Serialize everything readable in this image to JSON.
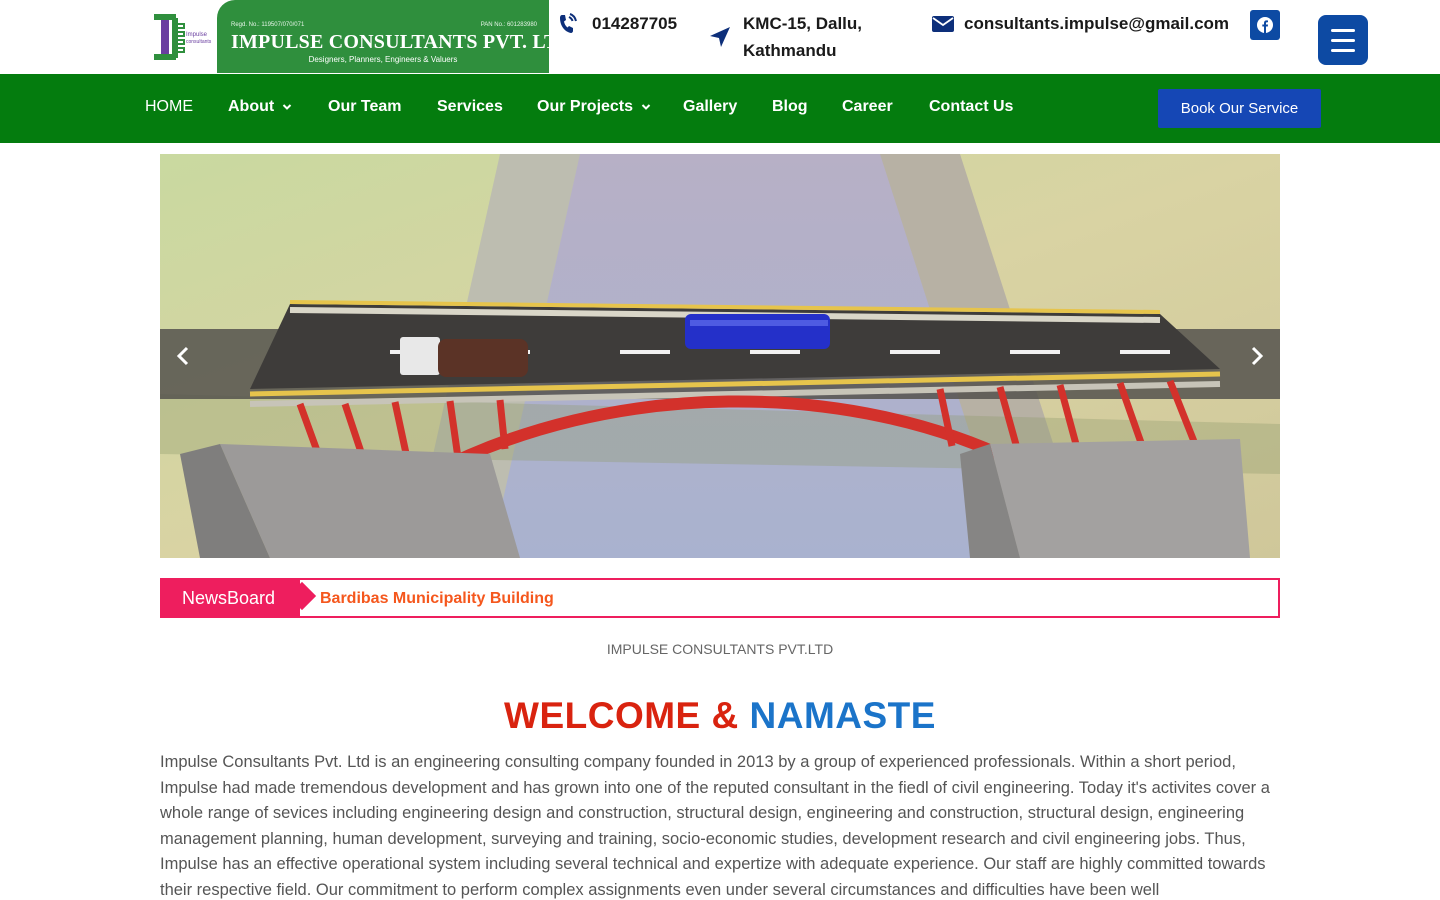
{
  "header": {
    "logo": {
      "company_name": "IMPULSE CONSULTANTS PVT. LTD.",
      "tagline": "Designers, Planners, Engineers & Valuers",
      "reg_no": "Regd. No.: 119507/070/071",
      "pan_no": "PAN No.: 601283980",
      "mark_text": "Impulse consultants"
    },
    "phone": "014287705",
    "address": "KMC-15, Dallu, Kathmandu",
    "email": "consultants.impulse@gmail.com",
    "social_icon": "facebook-icon",
    "menu_icon": "hamburger-icon"
  },
  "nav": {
    "items": [
      {
        "label": "HOME",
        "has_dropdown": false
      },
      {
        "label": "About",
        "has_dropdown": true
      },
      {
        "label": "Our Team",
        "has_dropdown": false
      },
      {
        "label": "Services",
        "has_dropdown": false
      },
      {
        "label": "Our Projects",
        "has_dropdown": true
      },
      {
        "label": "Gallery",
        "has_dropdown": false
      },
      {
        "label": "Blog",
        "has_dropdown": false
      },
      {
        "label": "Career",
        "has_dropdown": false
      },
      {
        "label": "Contact Us",
        "has_dropdown": false
      }
    ],
    "cta": "Book Our Service"
  },
  "hero": {
    "image": "bridge-rendering",
    "prev_icon": "chevron-left-icon",
    "next_icon": "chevron-right-icon"
  },
  "newsboard": {
    "label": "NewsBoard",
    "headline": "Bardibas Municipality Building"
  },
  "main": {
    "company_line": "IMPULSE CONSULTANTS PVT.LTD",
    "welcome_part1": "WELCOME &",
    "welcome_part2": "NAMASTE",
    "intro_text": "Impulse Consultants Pvt. Ltd is an engineering consulting company founded in 2013 by a group of experienced professionals.  Within a short period, Impulse had made tremendous development and has grown into one of the reputed consultant in the fiedl of civil engineering. Today it's activites cover a whole range of sevices including engineering design and construction, structural design, engineering and construction, structural design, engineering management planning, human development, surveying and training, socio-economic studies, development research and civil engineering jobs. Thus, Impulse has an effective operational system including several technical and expertize with adequate experience. Our staff are highly committed towards their respective field. Our commitment to perform complex assignments even under several circumstances and difficulties have been well"
  },
  "colors": {
    "nav_green": "#047c0e",
    "logo_green": "#2f8f3d",
    "primary_blue": "#0d4aa3",
    "news_pink": "#ee1e5e",
    "news_orange": "#f5571d",
    "welcome_red": "#d9230f",
    "welcome_blue": "#1b74c9"
  }
}
